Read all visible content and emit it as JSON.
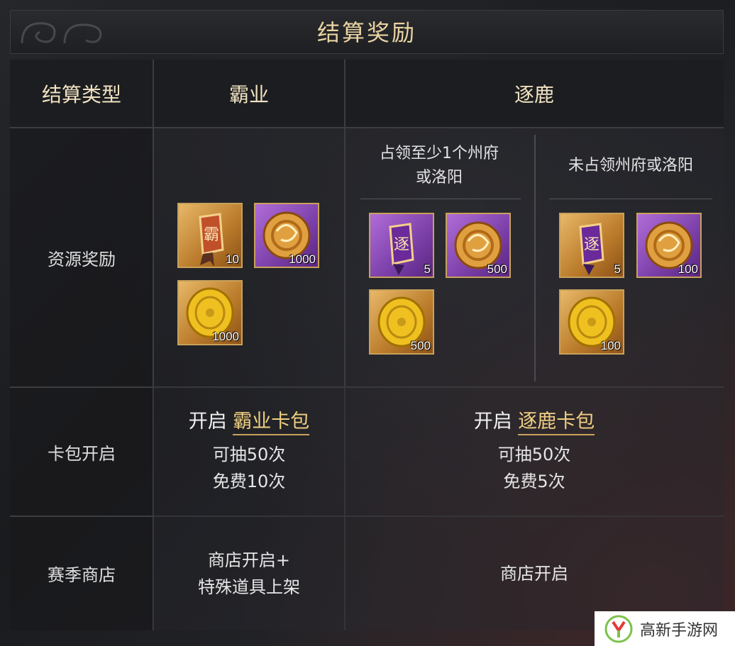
{
  "title": "结算奖励",
  "headers": {
    "type_label": "结算类型",
    "baye": "霸业",
    "zhulu": "逐鹿"
  },
  "zhulu_sub": {
    "occupied": "占领至少1个州府\n或洛阳",
    "occupied_line1": "占领至少1个州府",
    "occupied_line2": "或洛阳",
    "not_occupied": "未占领州府或洛阳"
  },
  "rows": {
    "resource": "资源奖励",
    "cardpack": "卡包开启",
    "shop": "赛季商店"
  },
  "resource_rewards": {
    "baye": [
      {
        "icon": "baye-banner-token-icon",
        "count": "10",
        "rarity": "orange"
      },
      {
        "icon": "jade-dragon-pendant-icon",
        "count": "1000",
        "rarity": "purple"
      },
      {
        "icon": "gold-coin-icon",
        "count": "1000",
        "rarity": "orange"
      }
    ],
    "zhulu_occupied": [
      {
        "icon": "zhulu-banner-token-icon",
        "count": "5",
        "rarity": "purple"
      },
      {
        "icon": "jade-dragon-pendant-icon",
        "count": "500",
        "rarity": "purple"
      },
      {
        "icon": "gold-coin-icon",
        "count": "500",
        "rarity": "orange"
      }
    ],
    "zhulu_not_occupied": [
      {
        "icon": "zhulu-banner-token-icon",
        "count": "5",
        "rarity": "orange"
      },
      {
        "icon": "jade-dragon-pendant-icon",
        "count": "100",
        "rarity": "purple"
      },
      {
        "icon": "gold-coin-icon",
        "count": "100",
        "rarity": "orange"
      }
    ]
  },
  "cardpack": {
    "baye": {
      "open": "开启",
      "name": "霸业卡包",
      "draws": "可抽50次",
      "free": "免费10次"
    },
    "zhulu": {
      "open": "开启",
      "name": "逐鹿卡包",
      "draws": "可抽50次",
      "free": "免费5次"
    }
  },
  "shop": {
    "baye_line1": "商店开启+",
    "baye_line2": "特殊道具上架",
    "zhulu": "商店开启"
  },
  "watermark": {
    "text": "高新手游网",
    "icon": "gaoxin-logo-icon"
  },
  "colors": {
    "gold": "#e9d3a3",
    "accent": "#f1cf82",
    "border": "#c8a15a"
  }
}
